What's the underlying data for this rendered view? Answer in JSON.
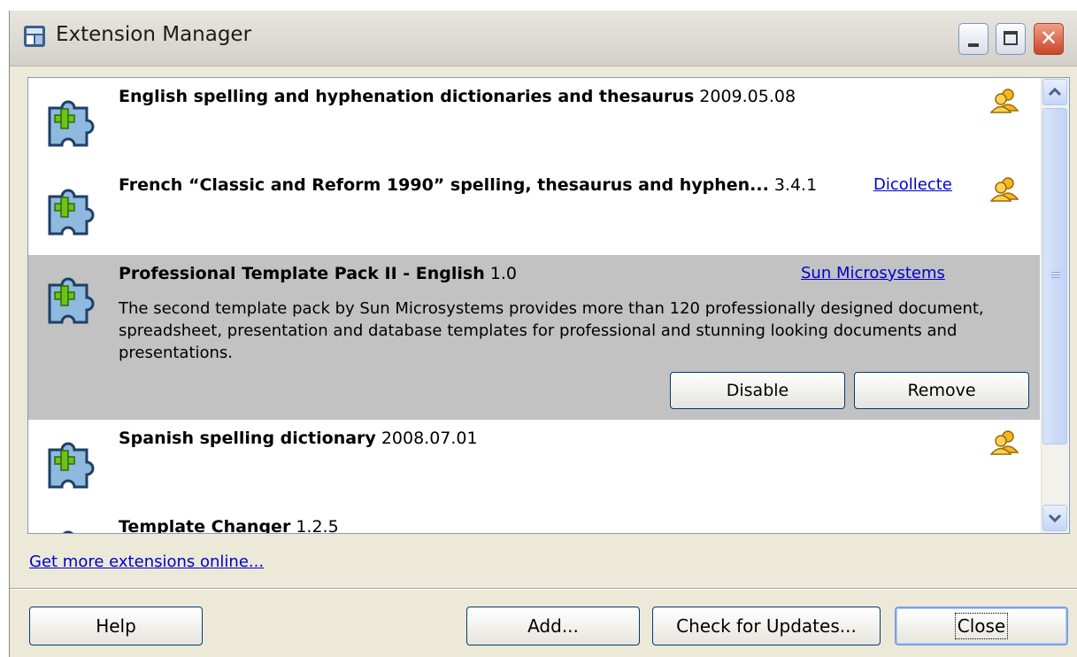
{
  "window": {
    "title": "Extension Manager",
    "controls": [
      "minimize",
      "maximize",
      "close"
    ]
  },
  "extensions": [
    {
      "name": "English spelling and hyphenation dictionaries and thesaurus",
      "version": "2009.05.08",
      "publisher": "",
      "icon": "puzzle-plus-icon",
      "shared": true
    },
    {
      "name": "French “Classic and Reform 1990” spelling, thesaurus and hyphen...",
      "version": "3.4.1",
      "publisher": "Dicollecte",
      "icon": "puzzle-plus-icon",
      "shared": true
    },
    {
      "name": "Professional Template Pack II - English",
      "version": "1.0",
      "publisher": "Sun Microsystems",
      "description": "The second template pack by Sun Microsystems provides more than 120 professionally designed document, spreadsheet, presentation and database templates for professional and stunning looking documents and presentations.",
      "selected": true,
      "disable_label": "Disable",
      "remove_label": "Remove",
      "icon": "puzzle-plus-icon",
      "shared": false
    },
    {
      "name": "Spanish spelling dictionary",
      "version": "2008.07.01",
      "publisher": "",
      "icon": "puzzle-plus-icon",
      "shared": true
    },
    {
      "name": "Template Changer",
      "version": "1.2.5",
      "icon": "puzzle-plus-icon"
    }
  ],
  "more_link": "Get more extensions online...",
  "buttons": {
    "help": "Help",
    "add": "Add...",
    "check_updates": "Check for Updates...",
    "close": "Close"
  },
  "colors": {
    "selected_row": "#c2c2c2",
    "link": "#0000cc",
    "window_bg": "#ece9d8"
  }
}
